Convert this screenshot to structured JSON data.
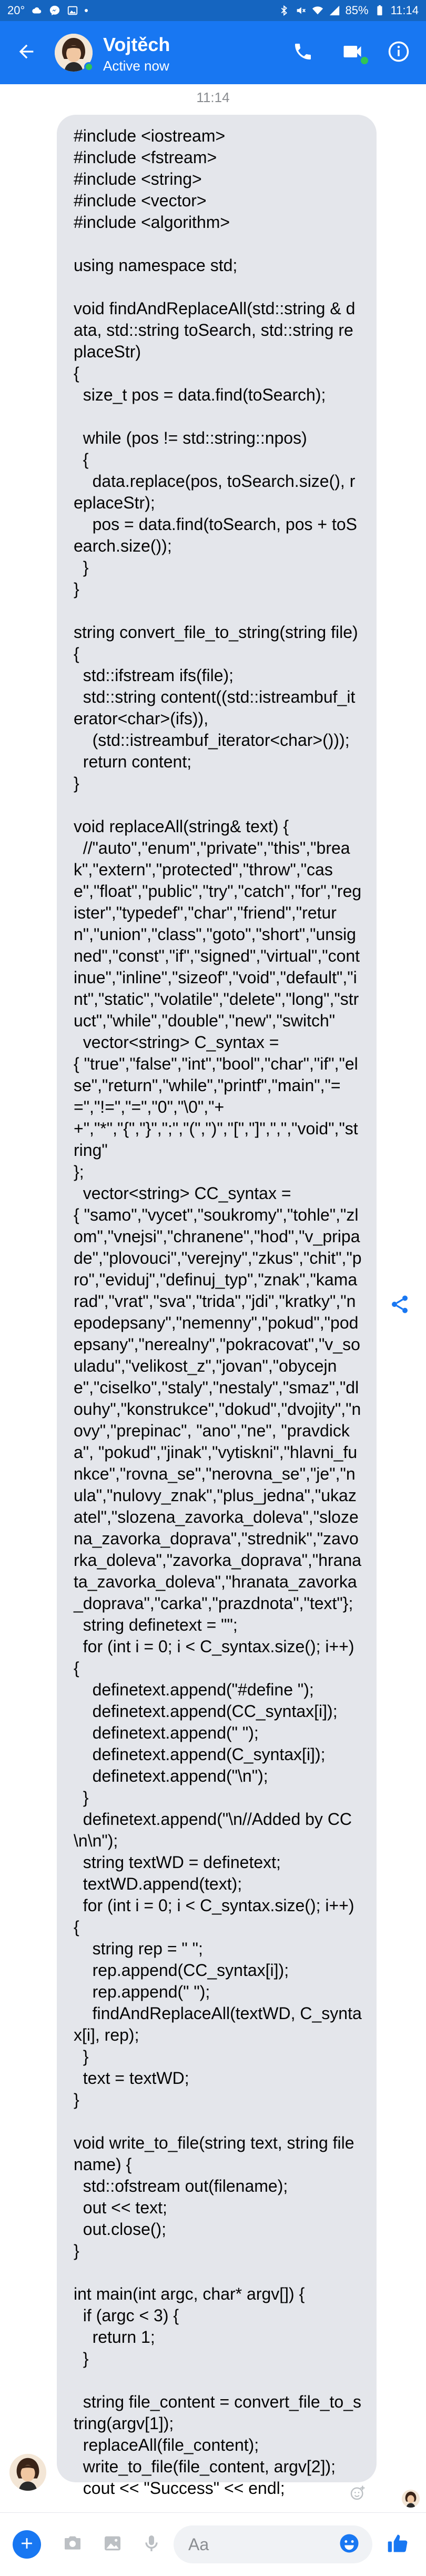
{
  "status_bar": {
    "left_text": "20°",
    "battery": "85%",
    "time": "11:14"
  },
  "header": {
    "contact_name": "Vojtěch",
    "contact_status": "Active now",
    "accent_color": "#1877f2",
    "icons": [
      "back-arrow-icon",
      "phone-icon",
      "video-camera-icon",
      "info-icon"
    ]
  },
  "thread": {
    "timestamp": "11:14",
    "message": "#include <iostream>\n#include <fstream>\n#include <string>\n#include <vector>\n#include <algorithm>\n\nusing namespace std;\n\nvoid findAndReplaceAll(std::string & data, std::string toSearch, std::string replaceStr)\n{\n  size_t pos = data.find(toSearch);\n\n  while (pos != std::string::npos)\n  {\n    data.replace(pos, toSearch.size(), replaceStr);\n    pos = data.find(toSearch, pos + toSearch.size());\n  }\n}\n\nstring convert_file_to_string(string file) {\n  std::ifstream ifs(file);\n  std::string content((std::istreambuf_iterator<char>(ifs)),\n    (std::istreambuf_iterator<char>()));\n  return content;\n}\n\nvoid replaceAll(string& text) {\n  //\"auto\",\"enum\",\"private\",\"this\",\"break\",\"extern\",\"protected\",\"throw\",\"case\",\"float\",\"public\",\"try\",\"catch\",\"for\",\"register\",\"typedef\",\"char\",\"friend\",\"return\",\"union\",\"class\",\"goto\",\"short\",\"unsigned\",\"const\",\"if\",\"signed\",\"virtual\",\"continue\",\"inline\",\"sizeof\",\"void\",\"default\",\"int\",\"static\",\"volatile\",\"delete\",\"long\",\"struct\",\"while\",\"double\",\"new\",\"switch\"\n  vector<string> C_syntax =\n{ \"true\",\"false\",\"int\",\"bool\",\"char\",\"if\",\"else\",\"return\",\"while\",\"printf\",\"main\",\"==\",\"!=\",\"=\",\"0\",\"\\0\",\"+\n+\",\"*\",\"{\",\"}\",\";\",\"(\",\")\",\"[\",\"]\",\",\",\"void\",\"string\"\n};\n  vector<string> CC_syntax =\n{ \"samo\",\"vycet\",\"soukromy\",\"tohle\",\"zlom\",\"vnejsi\",\"chranene\",\"hod\",\"v_pripade\",\"plovouci\",\"verejny\",\"zkus\",\"chit\",\"pro\",\"eviduj\",\"definuj_typ\",\"znak\",\"kamarad\",\"vrat\",\"sva\",\"trida\",\"jdi\",\"kratky\",\"nepodepsany\",\"nemenny\",\"pokud\",\"podepsany\",\"nerealny\",\"pokracovat\",\"v_souladu\",\"velikost_z\",\"jovan\",\"obycejne\",\"ciselko\",\"staly\",\"nestaly\",\"smaz\",\"dlouhy\",\"konstrukce\",\"dokud\",\"dvojity\",\"novy\",\"prepinac\", \"ano\",\"ne\", \"pravdicka\", \"pokud\",\"jinak\",\"vytiskni\",\"hlavni_funkce\",\"rovna_se\",\"nerovna_se\",\"je\",\"nula\",\"nulovy_znak\",\"plus_jedna\",\"ukazatel\",\"slozena_zavorka_doleva\",\"slozena_zavorka_doprava\",\"strednik\",\"zavorka_doleva\",\"zavorka_doprava\",\"hranata_zavorka_doleva\",\"hranata_zavorka_doprava\",\"carka\",\"prazdnota\",\"text\"};\n  string definetext = \"\";\n  for (int i = 0; i < C_syntax.size(); i++)\n{\n    definetext.append(\"#define \");\n    definetext.append(CC_syntax[i]);\n    definetext.append(\" \");\n    definetext.append(C_syntax[i]);\n    definetext.append(\"\\n\");\n  }\n  definetext.append(\"\\n//Added by CC\\n\\n\");\n  string textWD = definetext;\n  textWD.append(text);\n  for (int i = 0; i < C_syntax.size(); i++)\n{\n    string rep = \" \";\n    rep.append(CC_syntax[i]);\n    rep.append(\" \");\n    findAndReplaceAll(textWD, C_syntax[i], rep);\n  }\n  text = textWD;\n}\n\nvoid write_to_file(string text, string filename) {\n  std::ofstream out(filename);\n  out << text;\n  out.close();\n}\n\nint main(int argc, char* argv[]) {\n  if (argc < 3) {\n    return 1;\n  }\n\n  string file_content = convert_file_to_string(argv[1]);\n  replaceAll(file_content);\n  write_to_file(file_content, argv[2]);\n  cout << \"Success\" << endl;\n\n\n}"
  },
  "composer": {
    "placeholder": "Aa",
    "icons": [
      "plus-icon",
      "camera-icon",
      "image-icon",
      "microphone-icon",
      "emoji-icon",
      "thumbs-up-icon"
    ]
  }
}
